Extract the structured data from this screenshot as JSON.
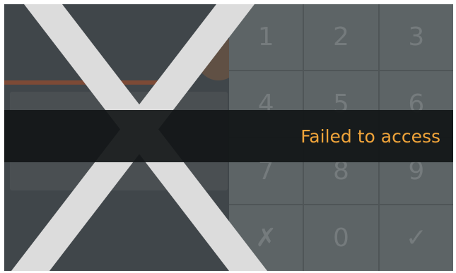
{
  "status": {
    "message": "Failed to access",
    "color": "#f0a43a"
  },
  "keypad": {
    "keys": [
      "1",
      "2",
      "3",
      "4",
      "5",
      "6",
      "7",
      "8",
      "9",
      "✗",
      "0",
      "✓"
    ]
  },
  "overlay": {
    "icon": "cross-icon"
  }
}
